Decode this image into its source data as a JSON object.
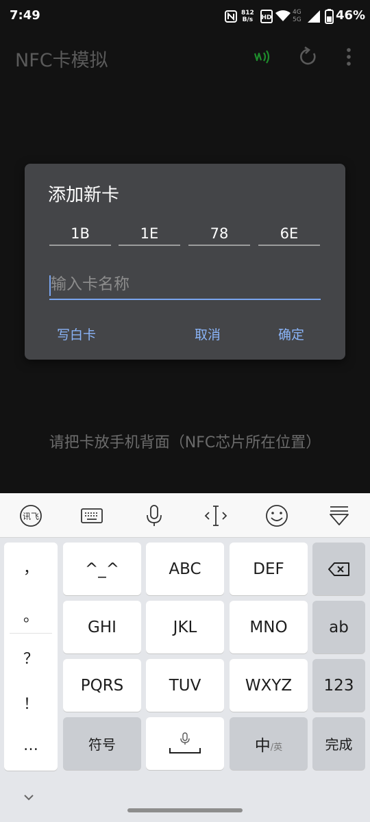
{
  "status": {
    "time": "7:49",
    "net_speed_top": "812",
    "net_speed_bottom": "B/s",
    "net_4g": "4G",
    "net_5g": "5G",
    "battery": "46%"
  },
  "app": {
    "title": "NFC卡模拟",
    "icons": [
      "nfc-icon",
      "refresh-icon",
      "more-icon"
    ],
    "nfc_color": "#1e8c2c"
  },
  "dialog": {
    "title": "添加新卡",
    "uid": [
      "1B",
      "1E",
      "78",
      "6E"
    ],
    "name_placeholder": "输入卡名称",
    "name_value": "",
    "btn_blank": "写白卡",
    "btn_cancel": "取消",
    "btn_ok": "确定",
    "accent": "#8ab4f8"
  },
  "hint": "请把卡放手机背面（NFC芯片所在位置）",
  "keyboard": {
    "toolbar_icons": [
      "ime-logo-icon",
      "keyboard-icon",
      "microphone-icon",
      "cursor-icon",
      "emoji-icon",
      "hide-keyboard-icon"
    ],
    "punctuation": [
      "，",
      "。",
      "？",
      "！",
      "…"
    ],
    "row1": [
      "^_^",
      "ABC",
      "DEF"
    ],
    "row2": [
      "GHI",
      "JKL",
      "MNO"
    ],
    "row3": [
      "PQRS",
      "TUV",
      "WXYZ"
    ],
    "backspace": "backspace-icon",
    "abc_mode": "ab",
    "num_mode": "123",
    "symbols": "符号",
    "lang_main": "中",
    "lang_alt": "/英",
    "done": "完成"
  }
}
